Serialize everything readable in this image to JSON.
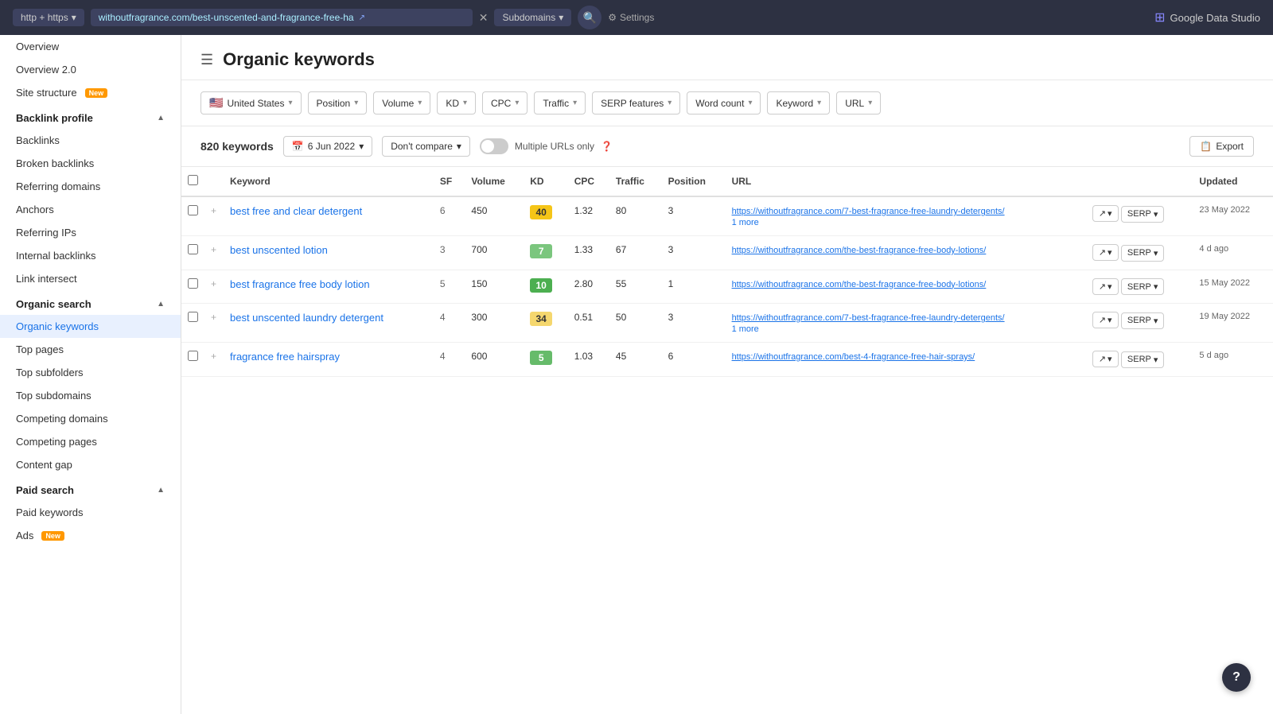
{
  "topbar": {
    "protocol": "http + https",
    "url": "withoutfragrance.com/best-unscented-and-fragrance-free-ha",
    "subdomains": "Subdomains",
    "settings": "Settings",
    "brand": "Google Data Studio"
  },
  "sidebar": {
    "nav_items": [
      {
        "id": "overview",
        "label": "Overview",
        "badge": null
      },
      {
        "id": "overview2",
        "label": "Overview 2.0",
        "badge": null
      },
      {
        "id": "site-structure",
        "label": "Site structure",
        "badge": "New"
      }
    ],
    "sections": [
      {
        "id": "backlink-profile",
        "label": "Backlink profile",
        "items": [
          {
            "id": "backlinks",
            "label": "Backlinks"
          },
          {
            "id": "broken-backlinks",
            "label": "Broken backlinks"
          },
          {
            "id": "referring-domains",
            "label": "Referring domains"
          },
          {
            "id": "anchors",
            "label": "Anchors"
          },
          {
            "id": "referring-ips",
            "label": "Referring IPs"
          },
          {
            "id": "internal-backlinks",
            "label": "Internal backlinks"
          },
          {
            "id": "link-intersect",
            "label": "Link intersect"
          }
        ]
      },
      {
        "id": "organic-search",
        "label": "Organic search",
        "items": [
          {
            "id": "organic-keywords",
            "label": "Organic keywords",
            "active": true
          },
          {
            "id": "top-pages",
            "label": "Top pages"
          },
          {
            "id": "top-subfolders",
            "label": "Top subfolders"
          },
          {
            "id": "top-subdomains",
            "label": "Top subdomains"
          },
          {
            "id": "competing-domains",
            "label": "Competing domains"
          },
          {
            "id": "competing-pages",
            "label": "Competing pages"
          },
          {
            "id": "content-gap",
            "label": "Content gap"
          }
        ]
      },
      {
        "id": "paid-search",
        "label": "Paid search",
        "items": [
          {
            "id": "paid-keywords",
            "label": "Paid keywords"
          },
          {
            "id": "ads",
            "label": "Ads",
            "badge": "New"
          }
        ]
      }
    ]
  },
  "page": {
    "title": "Organic keywords",
    "filters": [
      {
        "id": "country",
        "label": "United States",
        "flag": "🇺🇸",
        "has_chevron": true
      },
      {
        "id": "position",
        "label": "Position",
        "has_chevron": true
      },
      {
        "id": "volume",
        "label": "Volume",
        "has_chevron": true
      },
      {
        "id": "kd",
        "label": "KD",
        "has_chevron": true
      },
      {
        "id": "cpc",
        "label": "CPC",
        "has_chevron": true
      },
      {
        "id": "traffic",
        "label": "Traffic",
        "has_chevron": true
      },
      {
        "id": "serp-features",
        "label": "SERP features",
        "has_chevron": true
      },
      {
        "id": "word-count",
        "label": "Word count",
        "has_chevron": true
      },
      {
        "id": "keyword",
        "label": "Keyword",
        "has_chevron": true
      },
      {
        "id": "url",
        "label": "URL",
        "has_chevron": true
      }
    ],
    "toolbar": {
      "keyword_count": "820 keywords",
      "date": "6 Jun 2022",
      "compare": "Don't compare",
      "multiple_urls": "Multiple URLs only",
      "export": "Export"
    },
    "table": {
      "columns": [
        "Keyword",
        "SF",
        "Volume",
        "KD",
        "CPC",
        "Traffic",
        "Position",
        "URL",
        "",
        "Updated"
      ],
      "rows": [
        {
          "keyword": "best free and clear detergent",
          "sf": 6,
          "volume": 450,
          "kd": 40,
          "kd_class": "kd-yellow",
          "cpc": "1.32",
          "traffic": 80,
          "position": 3,
          "url": "https://withoutfragrance.com/7-best-fragrance-free-laundry-detergents/",
          "url_more": "1 more",
          "updated": "23 May 2022"
        },
        {
          "keyword": "best unscented lotion",
          "sf": 3,
          "volume": 700,
          "kd": 7,
          "kd_class": "kd-green-light",
          "cpc": "1.33",
          "traffic": 67,
          "position": 3,
          "url": "https://withoutfragrance.com/the-best-fragrance-free-body-lotions/",
          "url_more": null,
          "updated": "4 d ago"
        },
        {
          "keyword": "best fragrance free body lotion",
          "sf": 5,
          "volume": 150,
          "kd": 10,
          "kd_class": "kd-green",
          "cpc": "2.80",
          "traffic": 55,
          "position": 1,
          "url": "https://withoutfragrance.com/the-best-fragrance-free-body-lotions/",
          "url_more": null,
          "updated": "15 May 2022"
        },
        {
          "keyword": "best unscented laundry detergent",
          "sf": 4,
          "volume": 300,
          "kd": 34,
          "kd_class": "kd-yellow-light",
          "cpc": "0.51",
          "traffic": 50,
          "position": 3,
          "url": "https://withoutfragrance.com/7-best-fragrance-free-laundry-detergents/",
          "url_more": "1 more",
          "updated": "19 May 2022"
        },
        {
          "keyword": "fragrance free hairspray",
          "sf": 4,
          "volume": 600,
          "kd": 5,
          "kd_class": "kd-green2",
          "cpc": "1.03",
          "traffic": 45,
          "position": 6,
          "url": "https://withoutfragrance.com/best-4-fragrance-free-hair-sprays/",
          "url_more": null,
          "updated": "5 d ago"
        }
      ]
    }
  }
}
